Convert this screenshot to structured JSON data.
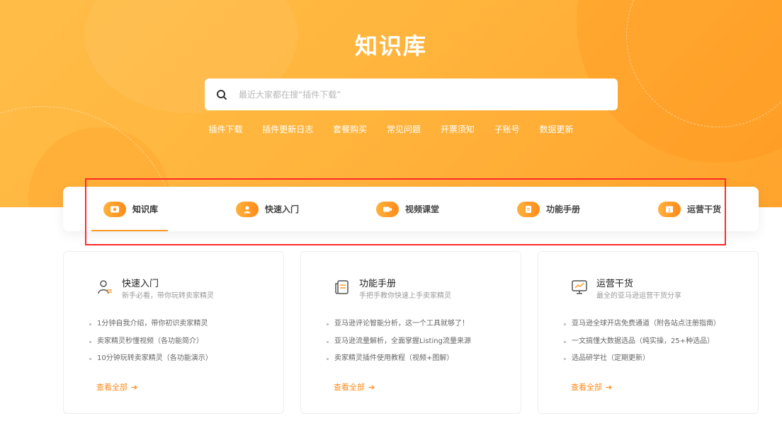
{
  "hero": {
    "title": "知识库",
    "search_placeholder": "最近大家都在搜“插件下载”",
    "quick_links": [
      "插件下载",
      "插件更新日志",
      "套餐购买",
      "常见问题",
      "开票须知",
      "子账号",
      "数据更新"
    ]
  },
  "tabs": [
    {
      "label": "知识库",
      "icon": "wallet-icon",
      "active": true
    },
    {
      "label": "快速入门",
      "icon": "user-icon",
      "active": false
    },
    {
      "label": "视频课堂",
      "icon": "video-icon",
      "active": false
    },
    {
      "label": "功能手册",
      "icon": "document-icon",
      "active": false
    },
    {
      "label": "运营干货",
      "icon": "chart-icon",
      "active": false
    }
  ],
  "cards": [
    {
      "icon": "user-icon",
      "title": "快速入门",
      "subtitle": "新手必看，带你玩转卖家精灵",
      "items": [
        "1分钟自我介绍，带你初识卖家精灵",
        "卖家精灵秒懂视频（各功能简介）",
        "10分钟玩转卖家精灵（各功能演示）"
      ],
      "more": "查看全部"
    },
    {
      "icon": "document-icon",
      "title": "功能手册",
      "subtitle": "手把手教你快速上手卖家精灵",
      "items": [
        "亚马逊评论智能分析，这一个工具就够了！",
        "亚马逊流量解析，全面掌握Listing流量来源",
        "卖家精灵插件使用教程（视频+图解）"
      ],
      "more": "查看全部"
    },
    {
      "icon": "chart-icon",
      "title": "运营干货",
      "subtitle": "最全的亚马逊运营干货分享",
      "items": [
        "亚马逊全球开店免费通道（附各站点注册指南）",
        "一文搞懂大数据选品（纯实操，25+种选品）",
        "选品研学社（定期更新）"
      ],
      "more": "查看全部"
    }
  ],
  "colors": {
    "accent": "#ff8a1a",
    "hero_bg": "#ffb43c",
    "highlight_border": "#ff2a2a"
  }
}
